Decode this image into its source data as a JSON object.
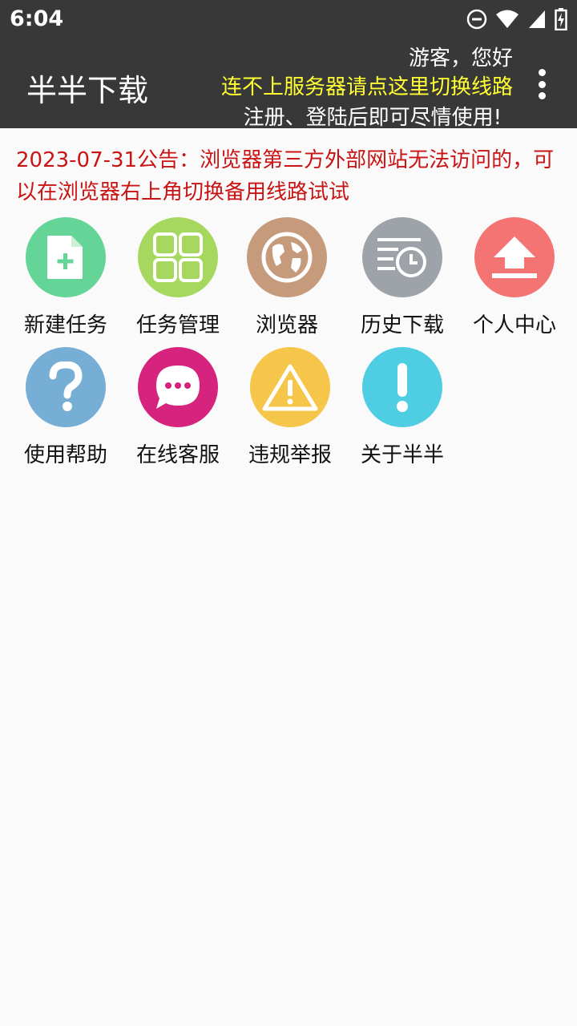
{
  "status_bar": {
    "time": "6:04",
    "icons": [
      "dnd-icon",
      "wifi-icon",
      "signal-icon",
      "battery-icon"
    ]
  },
  "app_bar": {
    "title": "半半下载",
    "greeting": "游客，您好",
    "switch_line": "连不上服务器请点这里切换线路",
    "login_hint": "注册、登陆后即可尽情使用!",
    "more_icon": "more-vert-icon"
  },
  "notice": {
    "text": "2023-07-31公告：浏览器第三方外部网站无法访问的，可以在浏览器右上角切换备用线路试试"
  },
  "grid": {
    "items": [
      {
        "label": "新建任务",
        "icon": "new-file-icon",
        "color": "#64d497"
      },
      {
        "label": "任务管理",
        "icon": "grid-icon",
        "color": "#a6d85f"
      },
      {
        "label": "浏览器",
        "icon": "globe-icon",
        "color": "#c69b7b"
      },
      {
        "label": "历史下载",
        "icon": "history-icon",
        "color": "#9ea3aa"
      },
      {
        "label": "个人中心",
        "icon": "upload-icon",
        "color": "#f47474"
      },
      {
        "label": "使用帮助",
        "icon": "help-icon",
        "color": "#77aed6"
      },
      {
        "label": "在线客服",
        "icon": "chat-icon",
        "color": "#d6237e"
      },
      {
        "label": "违规举报",
        "icon": "warning-icon",
        "color": "#f6c64b"
      },
      {
        "label": "关于半半",
        "icon": "info-icon",
        "color": "#4fcde2"
      }
    ]
  }
}
